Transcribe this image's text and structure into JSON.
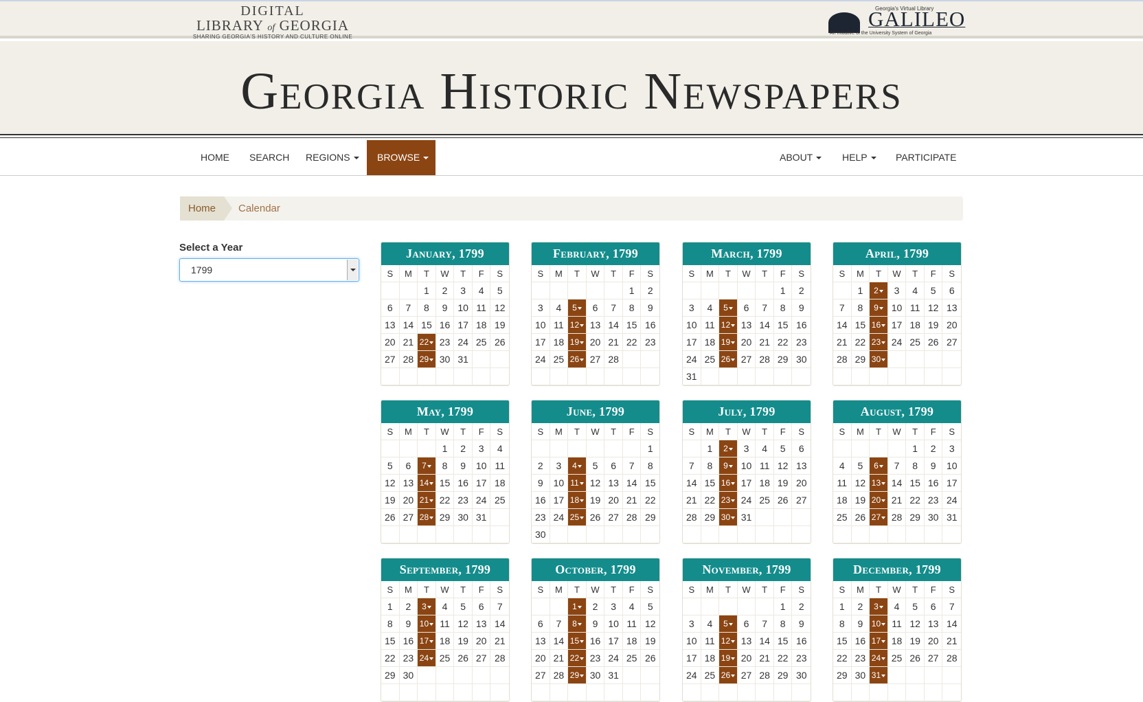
{
  "branding": {
    "dlg_line1": "DIGITAL",
    "dlg_line2a": "LIBRARY",
    "dlg_line2b": "of",
    "dlg_line2c": "GEORGIA",
    "dlg_tagline": "SHARING GEORGIA'S HISTORY AND CULTURE ONLINE",
    "galileo_sub": "Georgia's Virtual Library",
    "galileo_name": "GALILEO",
    "galileo_foot": "An Initiative of the University System of Georgia"
  },
  "site_title": "Georgia Historic Newspapers",
  "nav": {
    "home": "HOME",
    "search": "SEARCH",
    "regions": "REGIONS",
    "browse": "BROWSE",
    "about": "ABOUT",
    "help": "HELP",
    "participate": "PARTICIPATE"
  },
  "breadcrumb": {
    "home": "Home",
    "current": "Calendar"
  },
  "year_select": {
    "label": "Select a Year",
    "value": "1799"
  },
  "weekday_headers": [
    "S",
    "M",
    "T",
    "W",
    "T",
    "F",
    "S"
  ],
  "months": [
    {
      "title": "January, 1799",
      "first_weekday": 2,
      "days": 31,
      "issues": [
        22,
        29
      ]
    },
    {
      "title": "February, 1799",
      "first_weekday": 5,
      "days": 28,
      "issues": [
        5,
        12,
        19,
        26
      ]
    },
    {
      "title": "March, 1799",
      "first_weekday": 5,
      "days": 31,
      "issues": [
        5,
        12,
        19,
        26
      ]
    },
    {
      "title": "April, 1799",
      "first_weekday": 1,
      "days": 30,
      "issues": [
        2,
        9,
        16,
        23,
        30
      ]
    },
    {
      "title": "May, 1799",
      "first_weekday": 3,
      "days": 31,
      "issues": [
        7,
        14,
        21,
        28
      ]
    },
    {
      "title": "June, 1799",
      "first_weekday": 6,
      "days": 30,
      "issues": [
        4,
        11,
        18,
        25
      ]
    },
    {
      "title": "July, 1799",
      "first_weekday": 1,
      "days": 31,
      "issues": [
        2,
        9,
        16,
        23,
        30
      ]
    },
    {
      "title": "August, 1799",
      "first_weekday": 4,
      "days": 31,
      "issues": [
        6,
        13,
        20,
        27
      ]
    },
    {
      "title": "September, 1799",
      "first_weekday": 0,
      "days": 30,
      "issues": [
        3,
        10,
        17,
        24
      ]
    },
    {
      "title": "October, 1799",
      "first_weekday": 2,
      "days": 31,
      "issues": [
        1,
        8,
        15,
        22,
        29
      ]
    },
    {
      "title": "November, 1799",
      "first_weekday": 5,
      "days": 30,
      "issues": [
        5,
        12,
        19,
        26
      ]
    },
    {
      "title": "December, 1799",
      "first_weekday": 0,
      "days": 31,
      "issues": [
        3,
        10,
        17,
        24,
        31
      ]
    }
  ]
}
